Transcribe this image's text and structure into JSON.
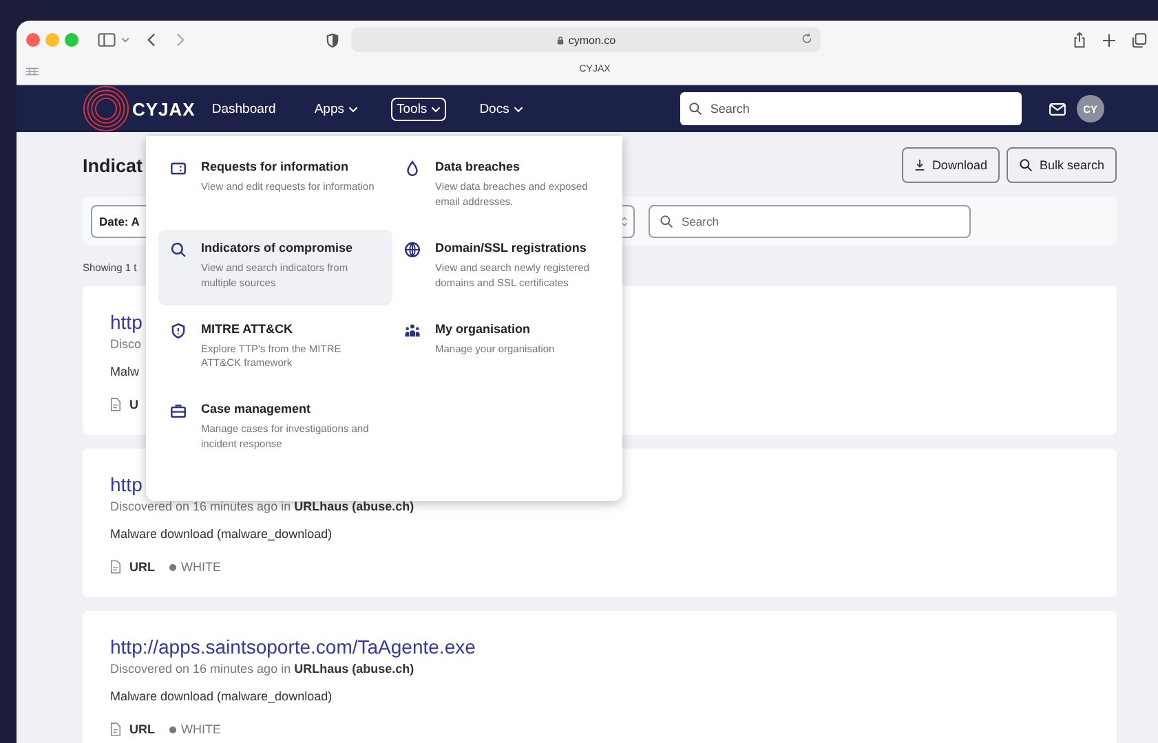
{
  "browser": {
    "url": "cymon.co",
    "tab_title": "CYJAX"
  },
  "nav": {
    "logo": "CYJAX",
    "items": [
      {
        "label": "Dashboard",
        "kind": "link",
        "expanded": false
      },
      {
        "label": "Apps",
        "kind": "menu",
        "expanded": false
      },
      {
        "label": "Tools",
        "kind": "menu",
        "expanded": true
      },
      {
        "label": "Docs",
        "kind": "menu",
        "expanded": false
      }
    ],
    "search": {
      "placeholder": "Search"
    },
    "avatar": "CY"
  },
  "page": {
    "title": "Indicat",
    "buttons": [
      "Download",
      "Bulk search"
    ],
    "filters": {
      "date": "Date: A",
      "search_placeholder": "Search"
    },
    "summary": "Showing 1 t"
  },
  "cards": [
    {
      "link": "http",
      "discovered": "Disco",
      "description": "Malw",
      "type": "U"
    },
    {
      "link": "http",
      "discovered": "Discovered on 16 minutes ago in **URLhaus (abuse.ch)**",
      "description": "Malware download (malware_download)",
      "type": "URL",
      "tlp": "WHITE"
    },
    {
      "link": "http://apps.saintsoporte.com/TaAgente.exe",
      "discovered": "Discovered on 16 minutes ago in **URLhaus (abuse.ch)**",
      "description": "Malware download (malware_download)",
      "type": "URL",
      "tlp": "WHITE"
    }
  ],
  "tools_menu": [
    {
      "title": "Requests for information",
      "description": "View and edit requests for information",
      "selected": false
    },
    {
      "title": "Data breaches",
      "description": "View data breaches and exposed email addresses.",
      "selected": false
    },
    {
      "title": "Indicators of compromise",
      "description": "View and search indicators from multiple sources",
      "selected": true
    },
    {
      "title": "Domain/SSL registrations",
      "description": "View and search newly registered domains and SSL certificates",
      "selected": false
    },
    {
      "title": "MITRE ATT&CK",
      "description": "Explore TTP's from the MITRE ATT&CK framework",
      "selected": false
    },
    {
      "title": "My organisation",
      "description": "Manage your organisation",
      "selected": false
    },
    {
      "title": "Case management",
      "description": "Manage cases for investigations and incident response",
      "selected": false
    }
  ]
}
